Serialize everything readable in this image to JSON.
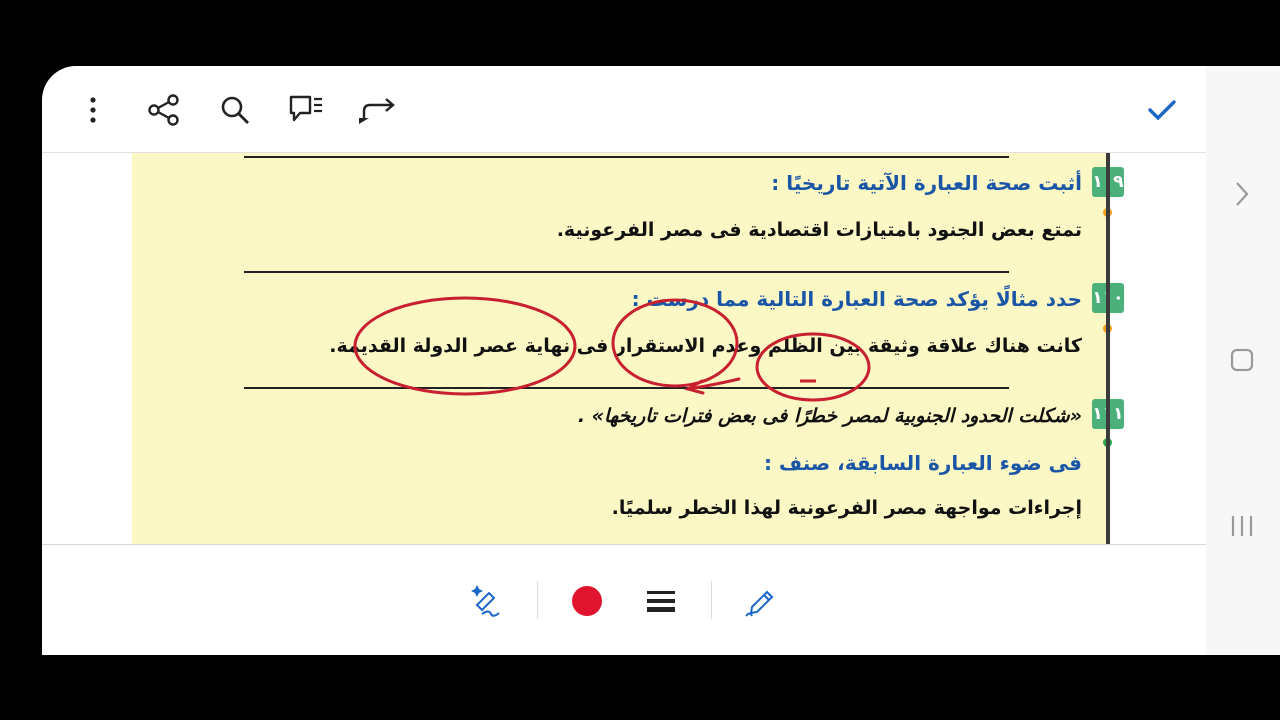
{
  "toolbar": {
    "icons": [
      "more-vertical-icon",
      "share-icon",
      "search-icon",
      "comment-icon",
      "redo-icon",
      "check-icon"
    ],
    "accent": "#1a66c9"
  },
  "document": {
    "questions": [
      {
        "number": "١٠٩",
        "prompt": "أثبت صحة العبارة الآتية تاريخيًا :",
        "body": "تمتع بعض الجنود بامتيازات اقتصادية فى مصر الفرعونية.",
        "dot_color": "#f0a21c"
      },
      {
        "number": "١١٠",
        "prompt": "حدد مثالًا يؤكد صحة العبارة التالية مما درست :",
        "body": "كانت هناك علاقة وثيقة بين الظلم وعدم الاستقرار فى نهاية عصر الدولة القديمة.",
        "dot_color": "#f0a21c"
      },
      {
        "number": "١١١",
        "quote": "«شكلت الحدود الجنوبية لمصر خطرًا فى بعض فترات تاريخها» .",
        "prompt": "فى ضوء العبارة السابقة، صنف :",
        "body": "إجراءات مواجهة مصر الفرعونية لهذا الخطر سلميًا.",
        "dot_color": "#2ca84a"
      }
    ],
    "page_color": "#fbf8c6",
    "annotation_color": "#c8202f"
  },
  "bottom_toolbar": {
    "icons": [
      "magic-pen-icon",
      "color-red-swatch",
      "stroke-width-icon",
      "pen-icon"
    ],
    "swatch_color": "#e0142e"
  },
  "system_nav": [
    "chevron-right-icon",
    "home-icon",
    "recents-icon"
  ]
}
